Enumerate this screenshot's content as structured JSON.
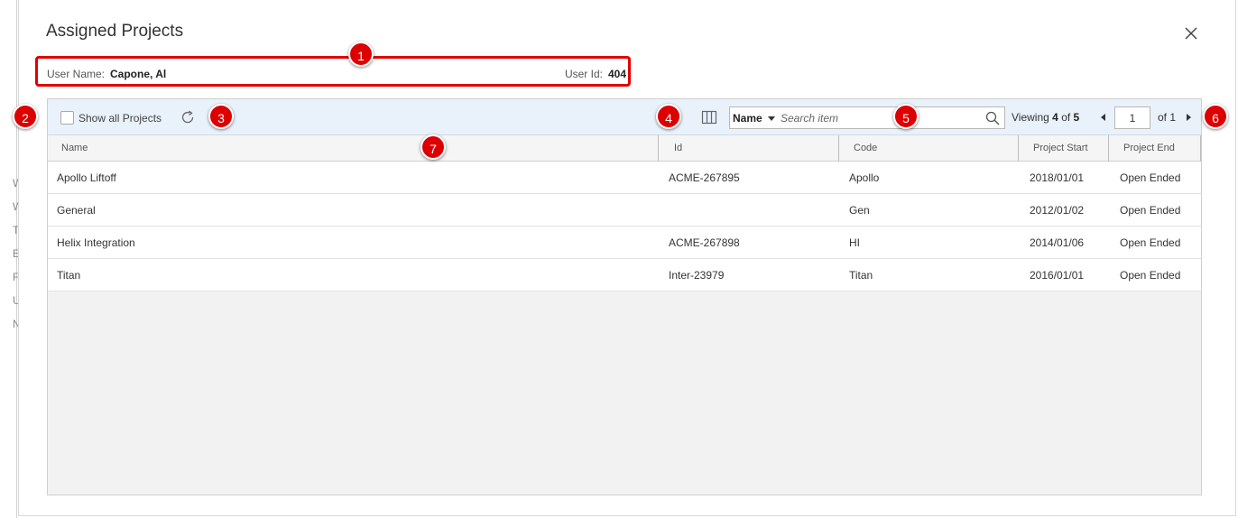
{
  "background": {
    "letters": [
      "W",
      "W",
      "T",
      "E",
      "F",
      "U",
      "N"
    ]
  },
  "dialog": {
    "title": "Assigned Projects",
    "user_name_label": "User Name:",
    "user_name_value": "Capone, Al",
    "user_id_label": "User Id:",
    "user_id_value": "404"
  },
  "toolbar": {
    "show_all_label": "Show all Projects",
    "search_field": "Name",
    "search_placeholder": "Search item",
    "viewing_prefix": "Viewing",
    "viewing_count": "4",
    "viewing_of": "of",
    "viewing_total": "5",
    "page_current": "1",
    "page_of_label": "of 1"
  },
  "columns": [
    "Name",
    "Id",
    "Code",
    "Project Start",
    "Project End"
  ],
  "rows": [
    {
      "name": "Apollo Liftoff",
      "id": "ACME-267895",
      "code": "Apollo",
      "start": "2018/01/01",
      "end": "Open Ended"
    },
    {
      "name": "General",
      "id": "",
      "code": "Gen",
      "start": "2012/01/02",
      "end": "Open Ended"
    },
    {
      "name": "Helix Integration",
      "id": "ACME-267898",
      "code": "HI",
      "start": "2014/01/06",
      "end": "Open Ended"
    },
    {
      "name": "Titan",
      "id": "Inter-23979",
      "code": "Titan",
      "start": "2016/01/01",
      "end": "Open Ended"
    }
  ],
  "callouts": [
    "1",
    "2",
    "3",
    "4",
    "5",
    "6",
    "7"
  ],
  "colors": {
    "callout": "#dd0000",
    "highlight_border": "#e00000",
    "toolbar_bg": "#e9f1fa"
  },
  "icons": {
    "close": "close-icon",
    "refresh": "refresh-icon",
    "columns": "column-chooser-icon",
    "search": "search-icon"
  }
}
